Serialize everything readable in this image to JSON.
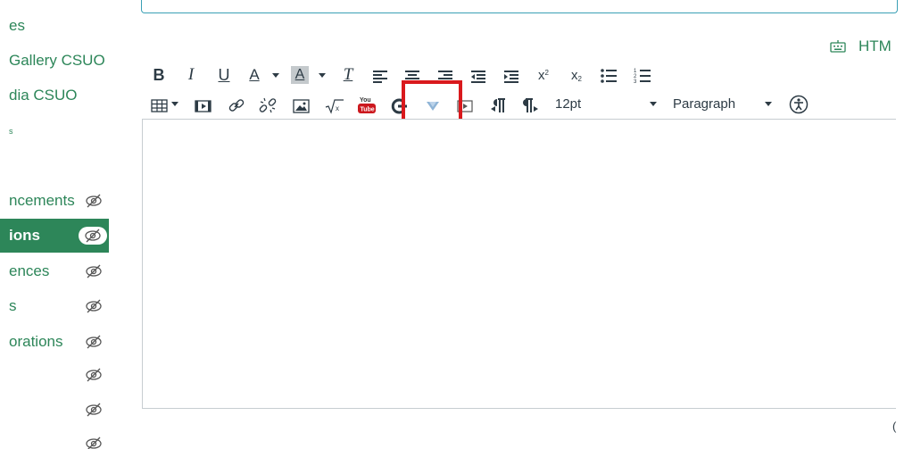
{
  "sidebar": {
    "items": [
      {
        "label": "es"
      },
      {
        "label": "Gallery CSUO"
      },
      {
        "label": "dia CSUO"
      },
      {
        "label": "s"
      },
      {
        "label": "ncements"
      },
      {
        "label": "ions"
      },
      {
        "label": "ences"
      },
      {
        "label": "s"
      },
      {
        "label": "orations"
      }
    ],
    "active_label": "ions"
  },
  "editor": {
    "html_toggle_label": "HTM",
    "font_size_value": "12pt",
    "block_format_value": "Paragraph",
    "word_count_fragment": "("
  },
  "toolbar": {
    "row1": [
      "bold",
      "italic",
      "underline",
      "text-color",
      "text-color-menu",
      "background-color",
      "background-color-menu",
      "clear-formatting",
      "align-left",
      "align-center",
      "align-right",
      "outdent",
      "indent",
      "superscript",
      "subscript",
      "bullet-list",
      "numbered-list"
    ],
    "row2": [
      "table",
      "table-menu",
      "media",
      "link",
      "unlink",
      "image",
      "equation",
      "youtube",
      "embed",
      "v-dropdown",
      "lti-tool",
      "ltr",
      "rtl"
    ],
    "bold_label": "B",
    "italic_label": "I",
    "underline_label": "U",
    "text_color_label": "A",
    "background_color_label": "A",
    "clear_formatting_label": "T",
    "superscript_label": "x",
    "subscript_label": "x"
  },
  "colors": {
    "accent_green": "#2d8659",
    "highlight_red": "#d9191d",
    "text": "#2d3b45"
  }
}
